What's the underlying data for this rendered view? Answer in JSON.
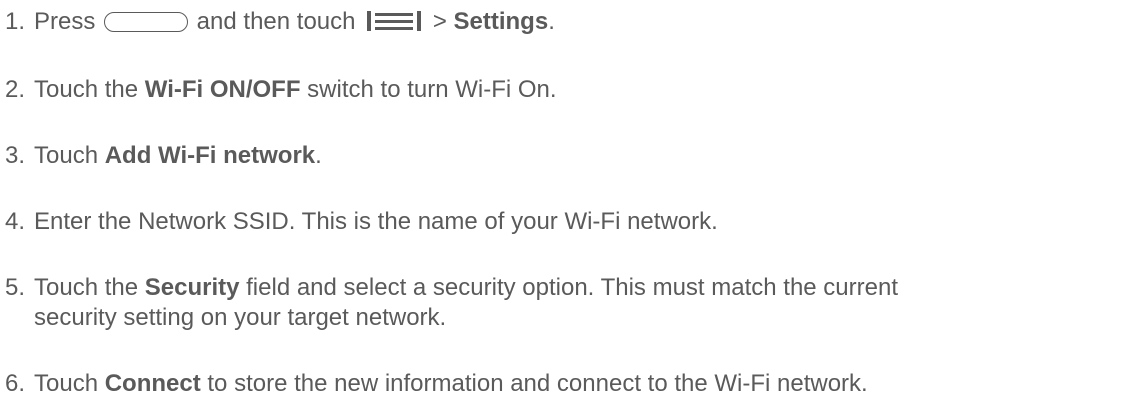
{
  "steps": [
    {
      "number": "1.",
      "pre": "Press ",
      "mid": " and then touch ",
      "post1": " > ",
      "bold1": "Settings",
      "post2": ".",
      "home_key_icon": "home-key-icon",
      "menu_key_icon": "menu-key-icon"
    },
    {
      "number": "2.",
      "pre": "Touch the ",
      "bold1": "Wi-Fi ON/OFF",
      "post1": " switch to turn Wi-Fi On."
    },
    {
      "number": "3.",
      "pre": "Touch ",
      "bold1": "Add Wi-Fi network",
      "post1": "."
    },
    {
      "number": "4.",
      "pre": "Enter the Network SSID. This is the name of your Wi-Fi network."
    },
    {
      "number": "5.",
      "pre": "Touch the ",
      "bold1": "Security",
      "post1": " field and select a security option. This must match the current",
      "line2": "security setting on your target network."
    },
    {
      "number": "6.",
      "pre": "Touch ",
      "bold1": "Connect",
      "post1": " to store the new information and connect to the Wi-Fi network."
    }
  ]
}
